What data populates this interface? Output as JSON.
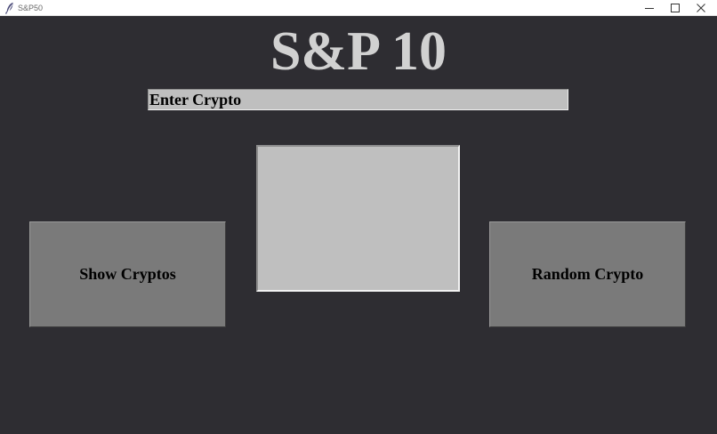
{
  "window": {
    "title": "S&P50",
    "icon": "feather-icon",
    "controls": [
      "minimize-icon",
      "maximize-icon",
      "close-icon"
    ]
  },
  "main": {
    "heading": "S&P 10",
    "input": {
      "value": "Enter Crypto"
    },
    "buttons": {
      "show_label": "Show Cryptos",
      "random_label": "Random Crypto"
    },
    "display_text": ""
  },
  "colors": {
    "background": "#2e2d32",
    "heading": "#d1d1d1",
    "field": "#bfbfbf",
    "button": "#7a7a7a"
  }
}
